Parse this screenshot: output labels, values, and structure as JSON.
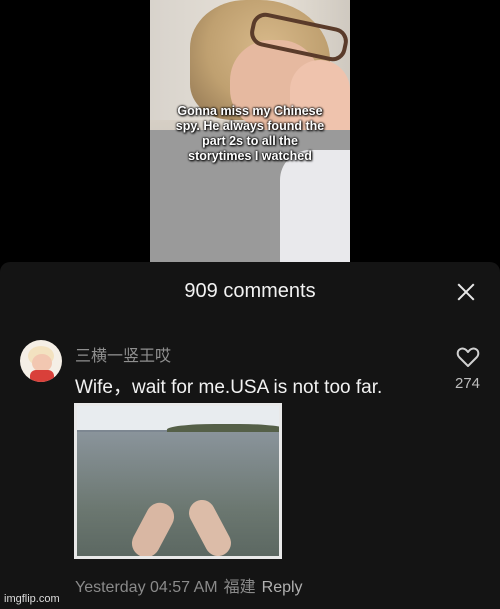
{
  "video": {
    "caption_lines": [
      "Gonna miss my Chinese",
      "spy. He always found the",
      "part 2s to all the",
      "storytimes I watched"
    ]
  },
  "comments_panel": {
    "title": "909 comments",
    "close_icon": "close-icon",
    "comment": {
      "username": "三横一竖王哎",
      "text": "Wife，wait for me.USA is not too far.",
      "like_icon": "heart-outline-icon",
      "like_count": "274",
      "time": "Yesterday 04:57 AM",
      "location": "福建",
      "reply_label": "Reply"
    }
  },
  "watermark": "imgflip.com",
  "colors": {
    "panel_bg": "#141414",
    "text_primary": "#f2f2f2",
    "text_secondary": "#8a8a8a"
  }
}
